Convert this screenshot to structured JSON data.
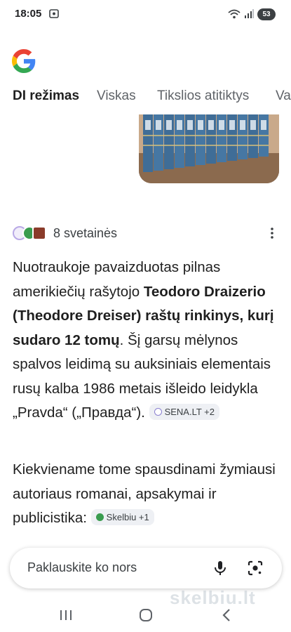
{
  "status_bar": {
    "time": "18:05",
    "battery": "53"
  },
  "tabs": [
    {
      "label": "DI režimas",
      "active": true
    },
    {
      "label": "Viskas",
      "active": false
    },
    {
      "label": "Tikslios atitiktys",
      "active": false
    },
    {
      "label": "Va",
      "active": false
    }
  ],
  "sources": {
    "label": "8 svetainės"
  },
  "answer": {
    "p1_text1": "Nuotraukoje pavaizduotas pilnas amerikiečių rašytojo ",
    "p1_bold": "Teodoro Draizerio (Theodore Dreiser) raštų rinkinys, kurį sudaro 12 tomų",
    "p1_text2": ". Šį garsų mėlynos spalvos leidimą su auksiniais elementais rusų kalba 1986 metais išleido leidykla „Pravda“ („Правда“).",
    "chip1": "SENA.LT +2",
    "p2_text": "Kiekviename tome spausdinami žymiausi autoriaus romanai, apsakymai ir publicistika:",
    "chip2": "Skelbiu +1"
  },
  "search": {
    "placeholder": "Paklauskite ko nors"
  },
  "watermark": "skelbiu.lt",
  "colors": {
    "accent_blue": "#4285F4",
    "accent_red": "#EA4335",
    "accent_yellow": "#FBBC05",
    "accent_green": "#34A853",
    "chip_bg": "#eef0f4"
  }
}
